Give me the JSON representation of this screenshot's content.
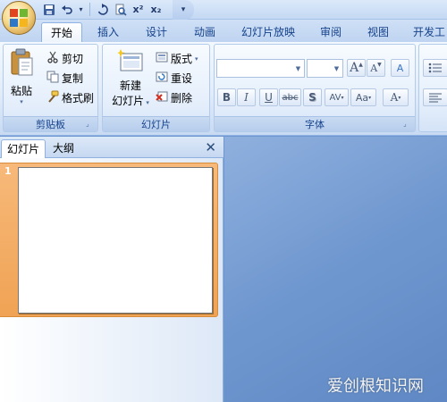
{
  "quick_access": {
    "items": [
      {
        "name": "save-icon",
        "glyph": "💾"
      },
      {
        "name": "undo-icon",
        "glyph": "↶"
      },
      {
        "name": "undo-dropdown-icon",
        "glyph": "▾"
      },
      {
        "name": "redo-icon",
        "glyph": "↻"
      },
      {
        "name": "print-preview-icon",
        "glyph": "🔍"
      },
      {
        "name": "superscript-icon",
        "glyph": "x²"
      },
      {
        "name": "subscript-icon",
        "glyph": "x₂"
      }
    ],
    "customize_glyph": "▾"
  },
  "tabs": [
    {
      "label": "开始",
      "active": true
    },
    {
      "label": "插入",
      "active": false
    },
    {
      "label": "设计",
      "active": false
    },
    {
      "label": "动画",
      "active": false
    },
    {
      "label": "幻灯片放映",
      "active": false
    },
    {
      "label": "审阅",
      "active": false
    },
    {
      "label": "视图",
      "active": false
    },
    {
      "label": "开发工",
      "active": false
    }
  ],
  "ribbon": {
    "clipboard": {
      "label": "剪贴板",
      "paste": "粘贴",
      "cut": "剪切",
      "copy": "复制",
      "format_painter": "格式刷"
    },
    "slides": {
      "label": "幻灯片",
      "new_slide_line1": "新建",
      "new_slide_line2": "幻灯片",
      "layout": "版式",
      "reset": "重设",
      "delete": "删除"
    },
    "font": {
      "label": "字体",
      "font_name": "",
      "font_size": "",
      "grow_glyph": "A",
      "shrink_glyph": "A",
      "clear_glyph": "A",
      "bold": "B",
      "italic": "I",
      "underline": "U",
      "strike": "abc",
      "shadow": "S",
      "spacing": "AV",
      "case": "Aa",
      "color": "A"
    }
  },
  "panel": {
    "tab_slides": "幻灯片",
    "tab_outline": "大纲",
    "close_glyph": "✕",
    "slide_number": "1"
  },
  "watermark": "爱创根知识网"
}
